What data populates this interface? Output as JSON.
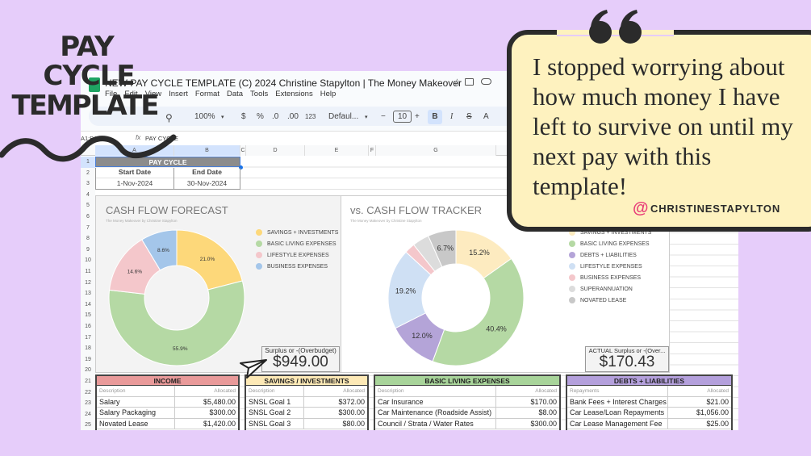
{
  "window": {
    "title": "NEW PAY CYCLE TEMPLATE (C) 2024 Christine Stapylton | The Money Makeover"
  },
  "menu": [
    "File",
    "Edit",
    "View",
    "Insert",
    "Format",
    "Data",
    "Tools",
    "Extensions",
    "Help"
  ],
  "toolbar": {
    "zoom": "100%",
    "currency": "$",
    "percent": "%",
    "dec_less": ".0",
    "dec_more": ".00",
    "number_format": "123",
    "font": "Defaul...",
    "font_size": "10",
    "bold": "B",
    "italic": "I",
    "strike": "S",
    "text_color": "A",
    "minus": "−",
    "plus": "+"
  },
  "formula_bar": {
    "name_box": "A1:B1",
    "fx": "fx",
    "value": "PAY CYCLE"
  },
  "columns": [
    "A",
    "B",
    "C",
    "D",
    "E",
    "F",
    "G"
  ],
  "rows": [
    "1",
    "2",
    "3",
    "4",
    "5",
    "6",
    "7",
    "8",
    "9",
    "10",
    "11",
    "12",
    "13",
    "14",
    "15",
    "16",
    "17",
    "18",
    "19",
    "20",
    "21",
    "22",
    "23",
    "24",
    "25"
  ],
  "pay_cycle": {
    "title": "PAY CYCLE",
    "start_label": "Start Date",
    "end_label": "End Date",
    "start": "1-Nov-2024",
    "end": "30-Nov-2024"
  },
  "chart_data": [
    {
      "type": "pie",
      "title": "CASH FLOW FORECAST",
      "subtitle": "The Money Makeover by Christine Stapylton",
      "legend_position": "right",
      "series": [
        {
          "name": "SAVINGS + INVESTMENTS",
          "value": 21.0,
          "label": "21.0%",
          "color": "#fdd87a"
        },
        {
          "name": "BASIC LIVING EXPENSES",
          "value": 55.9,
          "label": "55.9%",
          "color": "#b5d9a4"
        },
        {
          "name": "LIFESTYLE EXPENSES",
          "value": 14.6,
          "label": "14.6%",
          "color": "#f4c7cb"
        },
        {
          "name": "BUSINESS EXPENSES",
          "value": 8.6,
          "label": "8.6%",
          "color": "#a4c6ea"
        }
      ]
    },
    {
      "type": "pie",
      "title": "vs. CASH FLOW TRACKER",
      "subtitle": "The Money Makeover by Christine Stapylton",
      "legend_position": "right",
      "series": [
        {
          "name": "SAVINGS + INVESTMENTS",
          "value": 15.2,
          "label": "15.2%",
          "color": "#fdebc0"
        },
        {
          "name": "BASIC LIVING EXPENSES",
          "value": 40.4,
          "label": "40.4%",
          "color": "#b5d9a4"
        },
        {
          "name": "DEBTS + LIABILITIES",
          "value": 12.0,
          "label": "12.0%",
          "color": "#b4a4d8"
        },
        {
          "name": "LIFESTYLE EXPENSES",
          "value": 19.2,
          "label": "19.2%",
          "color": "#cfe0f4"
        },
        {
          "name": "BUSINESS EXPENSES",
          "value": 2.5,
          "label": "",
          "color": "#f4c7cb"
        },
        {
          "name": "SUPERANNUATION",
          "value": 4.0,
          "label": "",
          "color": "#dcdcdc"
        },
        {
          "name": "NOVATED LEASE",
          "value": 6.7,
          "label": "6.7%",
          "color": "#c8c8c8"
        }
      ]
    }
  ],
  "surplus_forecast": {
    "label": "Surplus or -(Overbudget)",
    "value": "$949.00"
  },
  "surplus_actual": {
    "label": "ACTUAL Surplus or -(Over...",
    "value": "$170.43"
  },
  "tables": [
    {
      "title": "INCOME",
      "color": "#e99a9a",
      "col1": "Description",
      "col2": "Allocated",
      "rows": [
        [
          "Salary",
          "$5,480.00"
        ],
        [
          "Salary Packaging",
          "$300.00"
        ],
        [
          "Novated Lease",
          "$1,420.00"
        ]
      ]
    },
    {
      "title": "SAVINGS / INVESTMENTS",
      "color": "#fde9b6",
      "col1": "Description",
      "col2": "Allocated",
      "rows": [
        [
          "SNSL Goal 1",
          "$372.00"
        ],
        [
          "SNSL Goal 2",
          "$300.00"
        ],
        [
          "SNSL Goal 3",
          "$80.00"
        ]
      ]
    },
    {
      "title": "BASIC LIVING EXPENSES",
      "color": "#a8d49a",
      "col1": "Description",
      "col2": "Allocated",
      "rows": [
        [
          "Car Insurance",
          "$170.00"
        ],
        [
          "Car Maintenance (Roadside Assist)",
          "$8.00"
        ],
        [
          "Council / Strata / Water Rates",
          "$300.00"
        ]
      ]
    },
    {
      "title": "DEBTS + LIABILITIES",
      "color": "#b4a0dc",
      "col1": "Repayments",
      "col2": "Allocated",
      "rows": [
        [
          "Bank Fees + Interest Charges",
          "$21.00"
        ],
        [
          "Car Lease/Loan Repayments",
          "$1,056.00"
        ],
        [
          "Car Lease Management Fee",
          "$25.00"
        ]
      ]
    }
  ],
  "logo": {
    "line1": "PAY",
    "line2": "CYCLE",
    "line3": "TEMPLATE"
  },
  "quote": {
    "text": "I stopped worrying about how much money I have left to survive on until my next pay with this template!",
    "handle": "CHRISTINESTAPYLTON",
    "at": "@"
  },
  "colors": {
    "background": "#e6cdfa",
    "quote_bg": "#fef2bf",
    "ink": "#2b2b2b"
  }
}
